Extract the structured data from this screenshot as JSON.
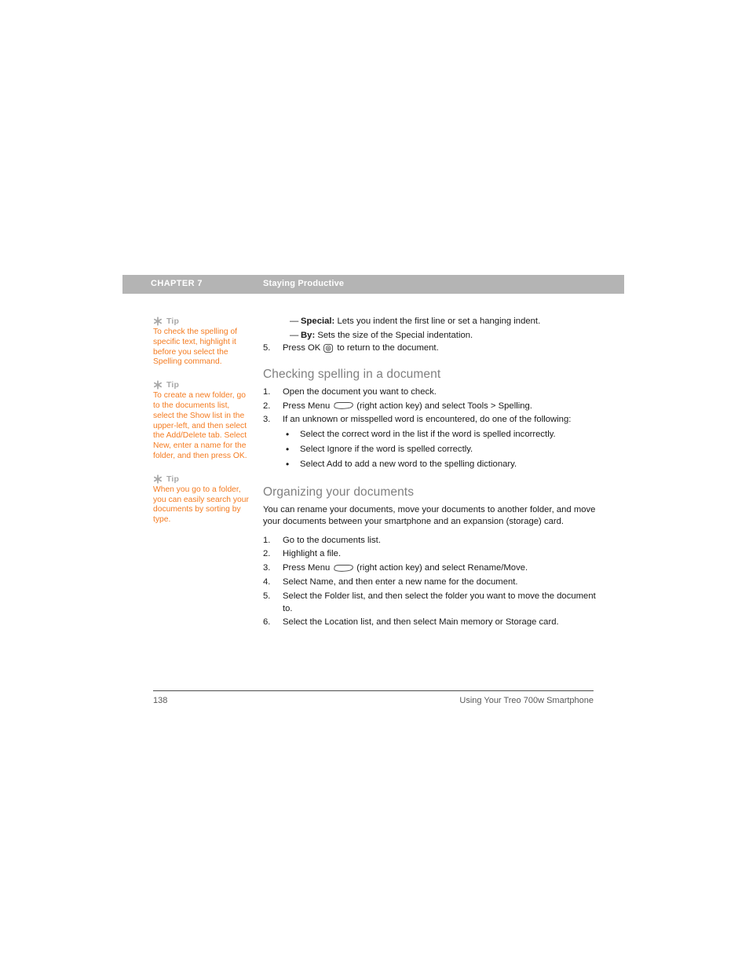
{
  "header": {
    "chapter_label": "CHAPTER 7",
    "section_label": "Staying Productive",
    "band_color": "#b4b4b4"
  },
  "sidebar": {
    "tip_label": "Tip",
    "tip_icon": "asterisk-icon",
    "accent_color": "#f47b20",
    "tips": [
      {
        "text": "To check the spelling of specific text, highlight it before you select the Spelling command."
      },
      {
        "text": "To create a new folder, go to the documents list, select the Show list in the upper-left, and then select the Add/Delete tab. Select New, enter a name for the folder, and then press OK."
      },
      {
        "text": "When you go to a folder, you can easily search your documents by sorting by type."
      }
    ]
  },
  "content": {
    "dash_items": [
      {
        "mark": "—",
        "term": "Special:",
        "text": " Lets you indent the first line or set a hanging indent."
      },
      {
        "mark": "—",
        "term": "By:",
        "text": " Sets the size of the Special indentation."
      }
    ],
    "continued_step": {
      "number": "5.",
      "before_icon": "Press OK",
      "icon": "ok-key-icon",
      "after_icon": "to return to the document."
    },
    "sections": [
      {
        "heading": "Checking spelling in a document",
        "steps": [
          {
            "number": "1.",
            "text": "Open the document you want to check."
          },
          {
            "number": "2.",
            "before_icon": "Press Menu",
            "icon": "menu-key-icon",
            "after_icon": "(right action key) and select Tools > Spelling."
          },
          {
            "number": "3.",
            "text": "If an unknown or misspelled word is encountered, do one of the following:",
            "bullets": [
              "Select the correct word in the list if the word is spelled incorrectly.",
              "Select Ignore if the word is spelled correctly.",
              "Select Add to add a new word to the spelling dictionary."
            ]
          }
        ]
      },
      {
        "heading": "Organizing your documents",
        "intro": "You can rename your documents, move your documents to another folder, and move your documents between your smartphone and an expansion (storage) card.",
        "steps": [
          {
            "number": "1.",
            "text": "Go to the documents list."
          },
          {
            "number": "2.",
            "text": "Highlight a file."
          },
          {
            "number": "3.",
            "before_icon": "Press Menu",
            "icon": "menu-key-icon",
            "after_icon": "(right action key) and select Rename/Move."
          },
          {
            "number": "4.",
            "text": "Select Name, and then enter a new name for the document."
          },
          {
            "number": "5.",
            "text": "Select the Folder list, and then select the folder you want to move the document to."
          },
          {
            "number": "6.",
            "text": "Select the Location list, and then select Main memory or Storage card."
          }
        ]
      }
    ]
  },
  "footer": {
    "page_number": "138",
    "title": "Using Your Treo 700w Smartphone"
  }
}
